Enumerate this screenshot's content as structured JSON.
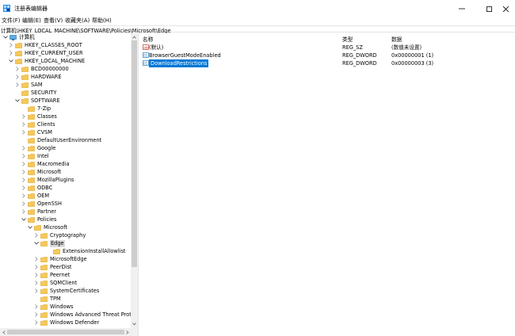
{
  "window": {
    "title": "注册表编辑器",
    "controls": {
      "minimize": "—",
      "maximize": "☐",
      "close": "✕"
    }
  },
  "menu": [
    "文件(F)",
    "编辑(E)",
    "查看(V)",
    "收藏夹(A)",
    "帮助(H)"
  ],
  "address": "计算机\\HKEY_LOCAL_MACHINE\\SOFTWARE\\Policies\\Microsoft\\Edge",
  "tree": [
    {
      "label": "计算机",
      "depth": 0,
      "state": "expanded",
      "kind": "computer"
    },
    {
      "label": "HKEY_CLASSES_ROOT",
      "depth": 1,
      "state": "collapsed"
    },
    {
      "label": "HKEY_CURRENT_USER",
      "depth": 1,
      "state": "collapsed"
    },
    {
      "label": "HKEY_LOCAL_MACHINE",
      "depth": 1,
      "state": "expanded"
    },
    {
      "label": "BCD00000000",
      "depth": 2,
      "state": "collapsed"
    },
    {
      "label": "HARDWARE",
      "depth": 2,
      "state": "collapsed"
    },
    {
      "label": "SAM",
      "depth": 2,
      "state": "collapsed"
    },
    {
      "label": "SECURITY",
      "depth": 2,
      "state": "none"
    },
    {
      "label": "SOFTWARE",
      "depth": 2,
      "state": "expanded"
    },
    {
      "label": "7-Zip",
      "depth": 3,
      "state": "none"
    },
    {
      "label": "Classes",
      "depth": 3,
      "state": "collapsed"
    },
    {
      "label": "Clients",
      "depth": 3,
      "state": "collapsed"
    },
    {
      "label": "CVSM",
      "depth": 3,
      "state": "collapsed"
    },
    {
      "label": "DefaultUserEnvironment",
      "depth": 3,
      "state": "none"
    },
    {
      "label": "Google",
      "depth": 3,
      "state": "collapsed"
    },
    {
      "label": "Intel",
      "depth": 3,
      "state": "collapsed"
    },
    {
      "label": "Macromedia",
      "depth": 3,
      "state": "collapsed"
    },
    {
      "label": "Microsoft",
      "depth": 3,
      "state": "collapsed"
    },
    {
      "label": "MozillaPlugins",
      "depth": 3,
      "state": "collapsed"
    },
    {
      "label": "ODBC",
      "depth": 3,
      "state": "collapsed"
    },
    {
      "label": "OEM",
      "depth": 3,
      "state": "collapsed"
    },
    {
      "label": "OpenSSH",
      "depth": 3,
      "state": "collapsed"
    },
    {
      "label": "Partner",
      "depth": 3,
      "state": "collapsed"
    },
    {
      "label": "Policies",
      "depth": 3,
      "state": "expanded"
    },
    {
      "label": "Microsoft",
      "depth": 4,
      "state": "expanded"
    },
    {
      "label": "Cryptography",
      "depth": 5,
      "state": "collapsed"
    },
    {
      "label": "Edge",
      "depth": 5,
      "state": "expanded",
      "selected": true
    },
    {
      "label": "ExtensionInstallAllowlist",
      "depth": 6,
      "state": "none"
    },
    {
      "label": "MicrosoftEdge",
      "depth": 5,
      "state": "collapsed"
    },
    {
      "label": "PeerDist",
      "depth": 5,
      "state": "collapsed"
    },
    {
      "label": "Peernet",
      "depth": 5,
      "state": "collapsed"
    },
    {
      "label": "SQMClient",
      "depth": 5,
      "state": "collapsed"
    },
    {
      "label": "SystemCertificates",
      "depth": 5,
      "state": "collapsed"
    },
    {
      "label": "TPM",
      "depth": 5,
      "state": "none"
    },
    {
      "label": "Windows",
      "depth": 5,
      "state": "collapsed"
    },
    {
      "label": "Windows Advanced Threat Protectic",
      "depth": 5,
      "state": "collapsed"
    },
    {
      "label": "Windows Defender",
      "depth": 5,
      "state": "collapsed"
    }
  ],
  "list": {
    "headers": {
      "name": "名称",
      "type": "类型",
      "data": "数据"
    },
    "rows": [
      {
        "name": "(默认)",
        "type": "REG_SZ",
        "data": "(数值未设置)",
        "icon": "string-value-icon"
      },
      {
        "name": "BrowserGuestModeEnabled",
        "type": "REG_DWORD",
        "data": "0x00000001 (1)",
        "icon": "dword-value-icon"
      },
      {
        "name": "DownloadRestrictions",
        "type": "REG_DWORD",
        "data": "0x00000003 (3)",
        "icon": "dword-value-icon",
        "selected": true
      }
    ]
  },
  "colors": {
    "selection": "#0078d7",
    "folder": "#f5c85a",
    "tree_selection": "#d9d9d9"
  }
}
